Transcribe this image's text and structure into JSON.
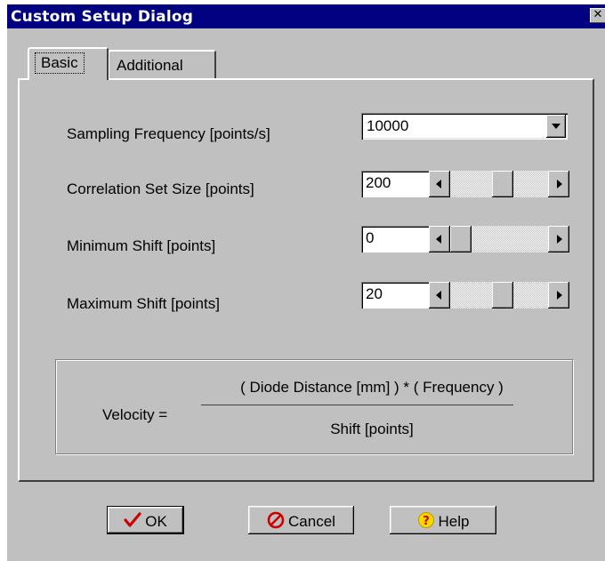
{
  "window": {
    "title": "Custom Setup Dialog",
    "close_glyph": "✕"
  },
  "tabs": [
    {
      "label": "Basic",
      "active": true
    },
    {
      "label": "Additional",
      "active": false
    }
  ],
  "fields": {
    "sampling_frequency": {
      "label": "Sampling Frequency [points/s]",
      "value": "10000"
    },
    "correlation_set_size": {
      "label": "Correlation Set Size [points]",
      "value": "200",
      "slider_fraction": 0.55
    },
    "minimum_shift": {
      "label": "Minimum Shift [points]",
      "value": "0",
      "slider_fraction": 0.0
    },
    "maximum_shift": {
      "label": "Maximum Shift [points]",
      "value": "20",
      "slider_fraction": 0.55
    }
  },
  "formula": {
    "lhs": "Velocity =",
    "numerator": "( Diode Distance [mm] ) * ( Frequency )",
    "denominator": "Shift [points]"
  },
  "buttons": {
    "ok": "OK",
    "cancel": "Cancel",
    "help": "Help"
  },
  "icons": {
    "ok": "checkmark-icon",
    "cancel": "prohibited-icon",
    "help": "question-icon",
    "close": "close-icon"
  },
  "colors": {
    "titlebar": "#000080",
    "face": "#c0c0c0",
    "ok_check": "#cc0000",
    "cancel_icon": "#cc0000",
    "help_icon": "#ffd800"
  }
}
